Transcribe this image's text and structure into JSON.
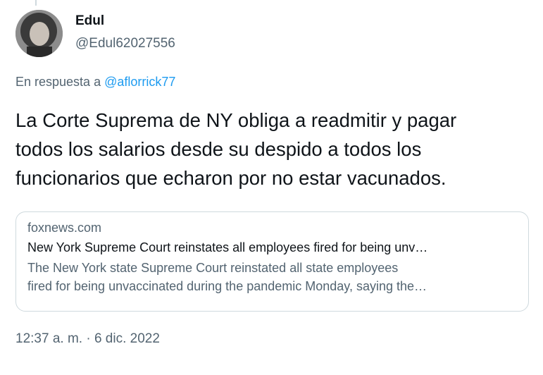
{
  "author": {
    "name": "Edul",
    "handle": "@Edul62027556"
  },
  "reply": {
    "prefix": "En respuesta a",
    "mention": "@aflorrick77"
  },
  "tweet": {
    "text_lines": [
      "La Corte Suprema de NY obliga a readmitir y pagar",
      "todos los salarios desde su despido a todos los",
      "funcionarios que echaron por no estar vacunados."
    ]
  },
  "card": {
    "domain": "foxnews.com",
    "title": "New York Supreme Court reinstates all employees fired for being unv…",
    "description_lines": [
      "The New York state Supreme Court reinstated all state employees",
      "fired for being unvaccinated during the pandemic Monday, saying the…"
    ]
  },
  "timestamp": "12:37 a. m. · 6 dic. 2022",
  "colors": {
    "text": "#0f1419",
    "secondary": "#536471",
    "link": "#1d9bf0",
    "border": "#cfd9de"
  }
}
